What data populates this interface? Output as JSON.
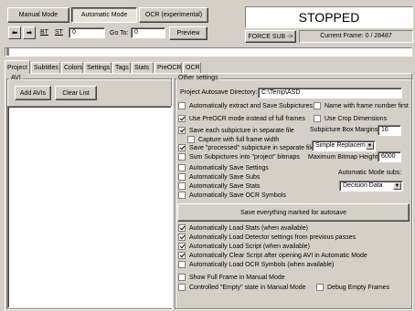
{
  "mode_buttons": {
    "manual": "Manual Mode",
    "automatic": "Automatic Mode",
    "ocr": "OCR (experimental)"
  },
  "status": {
    "text": "STOPPED",
    "force_sub": "FORCE SUB ->",
    "current_frame": "Current Frame: 0 / 28487"
  },
  "nav": {
    "bt": "BT",
    "st": "ST",
    "frame_value": "0",
    "goto_label": "Go To:",
    "goto_value": "0",
    "preview": "Preview"
  },
  "tabs": [
    "Project",
    "Subtitles",
    "Colors",
    "Settings",
    "Tags",
    "Stats",
    "PreOCR",
    "OCR"
  ],
  "avi": {
    "group": "AVI",
    "add": "Add AVIs",
    "clear": "Clear List"
  },
  "other": {
    "group": "Other settings",
    "dir_label": "Project Autosave Directory:",
    "dir_value": "C:\\Temp\\ASD",
    "auto_extract": "Automatically extract and Save Subpictures",
    "name_frame": "Name with frame number first",
    "use_preocr": "Use PreOCR mode instead of full frames",
    "use_crop": "Use Crop Dimensions",
    "save_each": "Save each subpicture in separate file",
    "box_margins_label": "Subpicture Box Margins:",
    "box_margins_value": "16",
    "capture_full": "Capture with full frame width",
    "save_processed": "Save \"processed\" subpicture in separate file",
    "replace_mode": "Simple Replaceme",
    "sum_subpictures": "Sum Subpictures into \"project\" bitmaps",
    "max_bitmap_label": "Maximum Bitmap Height:",
    "max_bitmap_value": "6000",
    "auto_save_settings": "Automatically Save Settings",
    "auto_save_subs": "Automatically Save Subs",
    "auto_mode_subs_label": "Automatic Mode subs:",
    "auto_save_stats": "Automatically Save Stats",
    "decision_data": "Decision Data",
    "auto_save_ocr": "Automatically Save OCR Symbols",
    "save_all": "Save everything marked for autosave",
    "load_stats": "Automatically Load Stats (when available)",
    "load_detector": "Automatically Load Detector settings from previous passes",
    "load_script": "Automatically Load Script (when available)",
    "clear_script": "Automatically Clear Script after opening AVI in Automatic Mode",
    "load_ocr": "Automatically Load OCR Symbols (when available)",
    "show_full_frame": "Show Full Frame in Manual Mode",
    "controlled_empty": "Controlled \"Empty\" state in Manual Mode",
    "debug_empty": "Debug Empty Frames"
  }
}
